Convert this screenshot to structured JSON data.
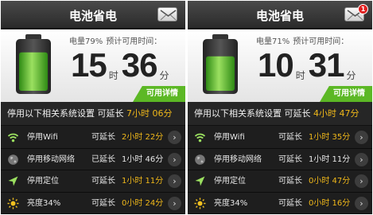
{
  "panels": [
    {
      "header": {
        "title": "电池省电"
      },
      "battery": {
        "level_percent": 79,
        "meta_label": "电量79%",
        "remaining_label": "预计可用时间："
      },
      "time": {
        "hours": "15",
        "hours_unit": "时",
        "minutes": "36",
        "minutes_unit": "分"
      },
      "details_button": "可用详情",
      "summary": {
        "label": "停用以下相关系统设置 可延长",
        "value": "7小时 06分"
      },
      "rows": [
        {
          "icon": "wifi-icon",
          "label": "停用Wifi",
          "ext": "可延长",
          "value": "2小时 22分",
          "value_color": "#f0b81a"
        },
        {
          "icon": "globe-icon",
          "label": "停用移动网络",
          "ext": "已延长",
          "value": "1小时 46分",
          "value_color": "#e8e8e8"
        },
        {
          "icon": "location-arrow-icon",
          "label": "停用定位",
          "ext": "可延长",
          "value": "1小时 11分",
          "value_color": "#f0b81a"
        },
        {
          "icon": "sun-icon",
          "label": "亮度34%",
          "ext": "可延长",
          "value": "0小时 24分",
          "value_color": "#f0b81a"
        }
      ]
    },
    {
      "header": {
        "title": "电池省电",
        "badge": "1"
      },
      "battery": {
        "level_percent": 71,
        "meta_label": "电量71%",
        "remaining_label": "预计可用时间："
      },
      "time": {
        "hours": "10",
        "hours_unit": "时",
        "minutes": "31",
        "minutes_unit": "分"
      },
      "details_button": "可用详情",
      "summary": {
        "label": "停用以下相关系统设置 可延长",
        "value": "4小时 47分"
      },
      "rows": [
        {
          "icon": "wifi-icon",
          "label": "停用Wifi",
          "ext": "可延长",
          "value": "1小时 35分",
          "value_color": "#f0b81a"
        },
        {
          "icon": "globe-icon",
          "label": "停用移动网络",
          "ext": "可延长",
          "value": "1小时 11分",
          "value_color": "#e8e8e8"
        },
        {
          "icon": "location-arrow-icon",
          "label": "停用定位",
          "ext": "可延长",
          "value": "0小时 47分",
          "value_color": "#f0b81a"
        },
        {
          "icon": "sun-icon",
          "label": "亮度34%",
          "ext": "可延长",
          "value": "0小时 16分",
          "value_color": "#f0b81a"
        }
      ]
    }
  ]
}
